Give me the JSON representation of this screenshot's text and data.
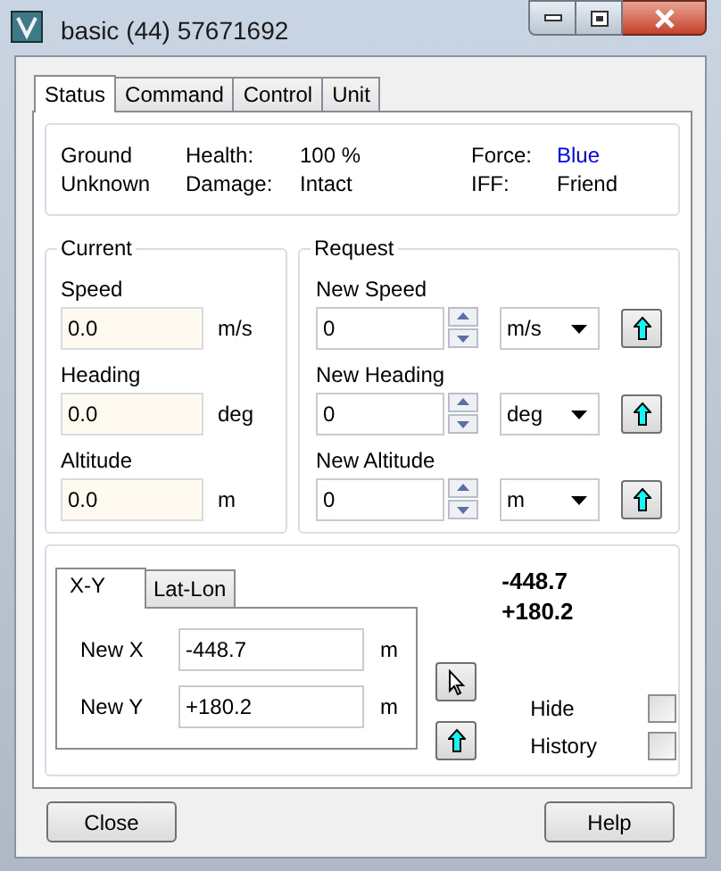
{
  "window": {
    "title": "basic (44) 57671692"
  },
  "tabs": [
    {
      "label": "Status",
      "selected": true
    },
    {
      "label": "Command",
      "selected": false
    },
    {
      "label": "Control",
      "selected": false
    },
    {
      "label": "Unit",
      "selected": false
    }
  ],
  "status": {
    "type": [
      "Ground",
      "Unknown"
    ],
    "fields": [
      {
        "label": "Health:",
        "value": "100 %",
        "color": "#000000"
      },
      {
        "label": "Damage:",
        "value": "Intact",
        "color": "#000000"
      }
    ],
    "side_fields": [
      {
        "label": "Force:",
        "value": "Blue",
        "color": "#0000ff"
      },
      {
        "label": "IFF:",
        "value": "Friend",
        "color": "#000000"
      }
    ]
  },
  "current": {
    "title": "Current",
    "fields": [
      {
        "label": "Speed",
        "value": "0.0",
        "unit": "m/s"
      },
      {
        "label": "Heading",
        "value": "0.0",
        "unit": "deg"
      },
      {
        "label": "Altitude",
        "value": "0.0",
        "unit": "m"
      }
    ]
  },
  "request": {
    "title": "Request",
    "fields": [
      {
        "label": "New Speed",
        "value": "0",
        "unit": "m/s"
      },
      {
        "label": "New Heading",
        "value": "0",
        "unit": "deg"
      },
      {
        "label": "New Altitude",
        "value": "0",
        "unit": "m"
      }
    ]
  },
  "position": {
    "tabs": [
      {
        "label": "X-Y",
        "selected": true
      },
      {
        "label": "Lat-Lon",
        "selected": false
      }
    ],
    "fields": [
      {
        "label": "New X",
        "value": "-448.7",
        "unit": "m"
      },
      {
        "label": "New Y",
        "value": "+180.2",
        "unit": "m"
      }
    ],
    "readout": [
      "-448.7",
      "+180.2"
    ],
    "checks": [
      {
        "label": "Hide",
        "checked": false
      },
      {
        "label": "History",
        "checked": false
      }
    ]
  },
  "buttons": [
    "Close",
    "Help"
  ]
}
